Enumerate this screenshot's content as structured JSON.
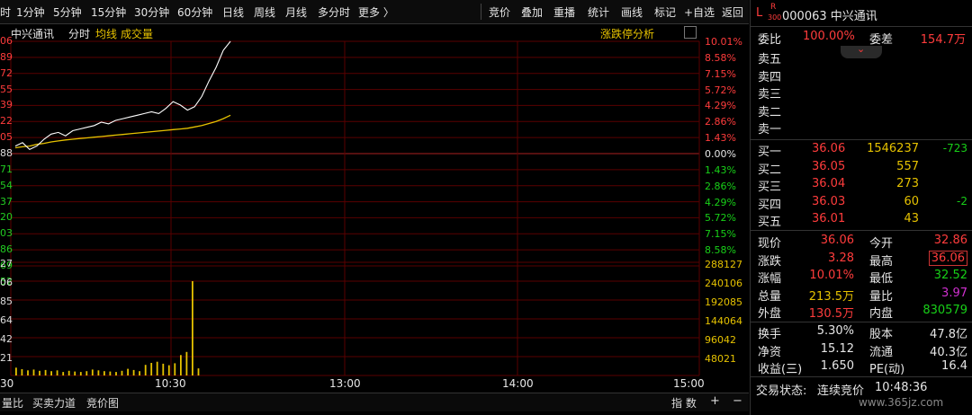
{
  "toolbar": {
    "left_tab": "时",
    "periods": [
      "1分钟",
      "5分钟",
      "15分钟",
      "30分钟",
      "60分钟",
      "日线",
      "周线",
      "月线",
      "多分时",
      "更多 〉"
    ],
    "tools": [
      "竞价",
      "叠加",
      "重播",
      "统计",
      "画线",
      "标记",
      "+自选",
      "返回"
    ]
  },
  "chart": {
    "stock_name": "中兴通讯",
    "mode": "分时",
    "avg_label": "均线",
    "vol_label": "成交量",
    "limit_analysis": "涨跌停分析",
    "left_price_labels": [
      "06",
      "89",
      "72",
      "55",
      "39",
      "22",
      "05",
      "88",
      "71",
      "54",
      "37",
      "20",
      "03",
      "86",
      "69",
      "52"
    ],
    "vol_left_labels": [
      "27",
      "06",
      "85",
      "64",
      "42",
      "21"
    ],
    "right_pct_up": [
      "10.01%",
      "8.58%",
      "7.15%",
      "5.72%",
      "4.29%",
      "2.86%",
      "1.43%"
    ],
    "right_zero": "0.00%",
    "right_pct_down": [
      "1.43%",
      "2.86%",
      "4.29%",
      "5.72%",
      "7.15%",
      "8.58%"
    ],
    "vol_ticks": [
      "288127",
      "240106",
      "192085",
      "144064",
      "96042",
      "48021"
    ],
    "x_labels": [
      "30",
      "10:30",
      "13:00",
      "14:00",
      "15:00"
    ],
    "colors": {
      "grid": "#5a0000",
      "price": "#ffffff",
      "avg": "#e6c200",
      "volume": "#e6c200",
      "up": "#ff3c3c",
      "down": "#18d018"
    }
  },
  "bottom": {
    "tabs": [
      "量比",
      "买卖力道",
      "竞价图"
    ],
    "right": [
      "指 数",
      "+",
      "−"
    ]
  },
  "quote": {
    "market_badge": "L",
    "badge_top": "R",
    "badge_bottom": "300",
    "code_name": "000063 中兴通讯",
    "weibi_label": "委比",
    "weibi": "100.00%",
    "weicha_label": "委差",
    "weicha": "154.7万",
    "sell_labels": [
      "卖五",
      "卖四",
      "卖三",
      "卖二",
      "卖一"
    ],
    "buys": [
      {
        "label": "买一",
        "price": "36.06",
        "vol": "1546237",
        "chg": "-723"
      },
      {
        "label": "买二",
        "price": "36.05",
        "vol": "557",
        "chg": ""
      },
      {
        "label": "买三",
        "price": "36.04",
        "vol": "273",
        "chg": ""
      },
      {
        "label": "买四",
        "price": "36.03",
        "vol": "60",
        "chg": "-2"
      },
      {
        "label": "买五",
        "price": "36.01",
        "vol": "43",
        "chg": ""
      }
    ],
    "stats": [
      {
        "l1": "现价",
        "v1": "36.06",
        "l2": "今开",
        "v2": "32.86"
      },
      {
        "l1": "涨跌",
        "v1": "3.28",
        "l2": "最高",
        "v2": "36.06"
      },
      {
        "l1": "涨幅",
        "v1": "10.01%",
        "l2": "最低",
        "v2": "32.52"
      },
      {
        "l1": "总量",
        "v1": "213.5万",
        "l2": "量比",
        "v2": "3.97"
      },
      {
        "l1": "外盘",
        "v1": "130.5万",
        "l2": "内盘",
        "v2": "830579"
      }
    ],
    "stats2": [
      {
        "l1": "换手",
        "v1": "5.30%",
        "l2": "股本",
        "v2": "47.8亿"
      },
      {
        "l1": "净资",
        "v1": "15.12",
        "l2": "流通",
        "v2": "40.3亿"
      },
      {
        "l1": "收益(㆔)",
        "v1": "1.650",
        "l2": "PE(动)",
        "v2": "16.4"
      }
    ],
    "status_label": "交易状态:",
    "status_value": "连续竞价",
    "time": "10:48:36",
    "watermark": "www.365jz.com"
  },
  "chart_data": {
    "type": "line",
    "title": "",
    "price_series": [
      33.0,
      33.1,
      32.9,
      33.0,
      33.2,
      33.35,
      33.4,
      33.3,
      33.45,
      33.5,
      33.55,
      33.6,
      33.7,
      33.65,
      33.75,
      33.8,
      33.85,
      33.9,
      33.95,
      34.0,
      33.95,
      34.1,
      34.3,
      34.2,
      34.05,
      34.15,
      34.45,
      34.9,
      35.3,
      35.8,
      36.06
    ],
    "avg_series": [
      32.95,
      32.98,
      33.0,
      33.05,
      33.08,
      33.12,
      33.15,
      33.18,
      33.2,
      33.22,
      33.24,
      33.26,
      33.28,
      33.3,
      33.32,
      33.34,
      33.36,
      33.38,
      33.4,
      33.42,
      33.44,
      33.46,
      33.48,
      33.5,
      33.52,
      33.56,
      33.6,
      33.66,
      33.72,
      33.8,
      33.9
    ],
    "volume": [
      20000,
      16000,
      13000,
      15000,
      12000,
      14000,
      11000,
      13000,
      9000,
      12000,
      10000,
      9000,
      11000,
      15000,
      13000,
      11000,
      10000,
      9000,
      12000,
      17000,
      14000,
      11000,
      27000,
      32000,
      35000,
      30000,
      26000,
      31000,
      52000,
      60000,
      240000,
      18000
    ],
    "ylim_pct": [
      -10.01,
      10.01
    ],
    "vol_ylim": [
      0,
      288127
    ]
  }
}
